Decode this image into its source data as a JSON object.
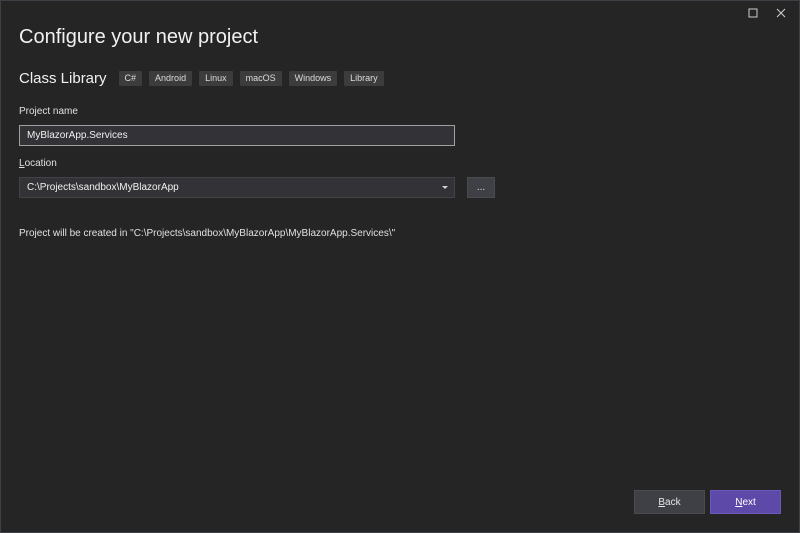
{
  "window": {
    "maximize_icon": "maximize-icon",
    "close_icon": "close-icon"
  },
  "page": {
    "title": "Configure your new project"
  },
  "template": {
    "name": "Class Library",
    "tags": [
      "C#",
      "Android",
      "Linux",
      "macOS",
      "Windows",
      "Library"
    ]
  },
  "project_name": {
    "label": "Project name",
    "value": "MyBlazorApp.Services"
  },
  "location": {
    "label_access_key": "L",
    "label_rest": "ocation",
    "value": "C:\\Projects\\sandbox\\MyBlazorApp",
    "browse_label": "..."
  },
  "path_note": "Project will be created in \"C:\\Projects\\sandbox\\MyBlazorApp\\MyBlazorApp.Services\\\"",
  "footer": {
    "back_access_key": "B",
    "back_rest": "ack",
    "next_access_key": "N",
    "next_rest": "ext"
  },
  "colors": {
    "background": "#252526",
    "accent": "#5c49a8",
    "input_bg": "#333337"
  }
}
